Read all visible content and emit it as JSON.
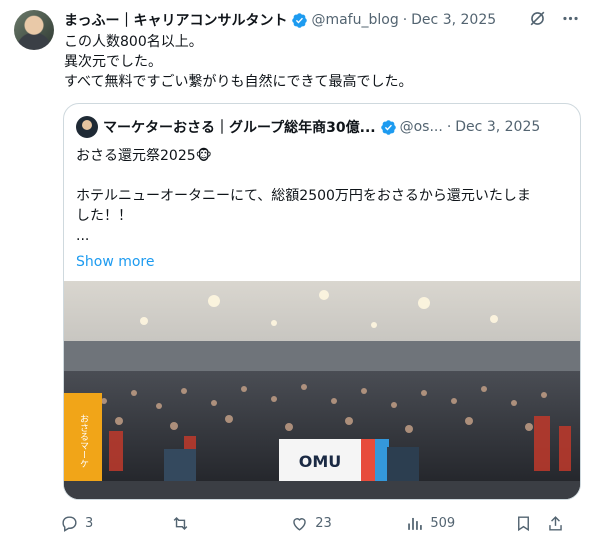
{
  "author": {
    "name": "まっふー｜キャリアコンサルタント",
    "handle": "@mafu_blog",
    "date": "Dec 3, 2025"
  },
  "tweet": {
    "lines": [
      "この人数800名以上。",
      "異次元でした。",
      "すべて無料ですごい繋がりも自然にできて最高でした。"
    ]
  },
  "quote": {
    "name": "マーケターおさる｜グループ総年商30億...",
    "handle": "@os...",
    "date": "Dec 3, 2025",
    "lines": [
      "おさる還元祭2025🐵",
      "",
      "ホテルニューオータニーにて、総額2500万円をおさるから還元いたしま",
      "した！！",
      "..."
    ],
    "show_more": "Show more",
    "photo_sign": "OMU",
    "photo_banner": "おさるマーケ"
  },
  "actions": {
    "replies": "3",
    "reposts": "",
    "likes": "23",
    "views": "509"
  },
  "icons": [
    "verified-badge-icon",
    "grok-icon",
    "more-icon",
    "reply-icon",
    "repost-icon",
    "like-icon",
    "views-icon",
    "bookmark-icon",
    "share-icon"
  ],
  "colors": {
    "accent": "#1d9bf0",
    "muted": "#536471",
    "border": "#cfd9de"
  }
}
